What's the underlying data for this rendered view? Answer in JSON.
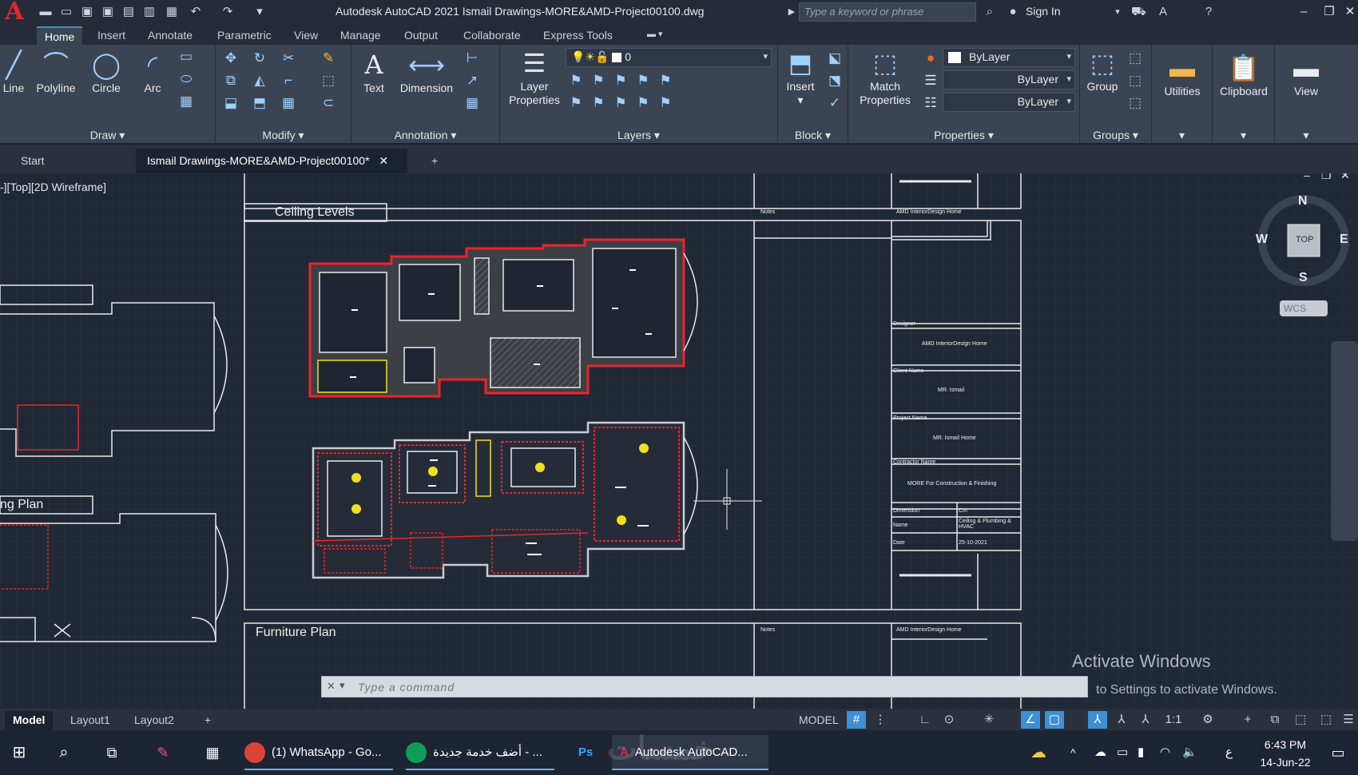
{
  "titlebar": {
    "app_title": "Autodesk AutoCAD 2021   Ismail Drawings-MORE&AMD-Project00100.dwg",
    "search_placeholder": "Type a keyword or phrase",
    "sign_in": "Sign In"
  },
  "ribbon_tabs": [
    "Home",
    "Insert",
    "Annotate",
    "Parametric",
    "View",
    "Manage",
    "Output",
    "Collaborate",
    "Express Tools"
  ],
  "panels": {
    "draw": {
      "title": "Draw",
      "tools": [
        "Line",
        "Polyline",
        "Circle",
        "Arc"
      ]
    },
    "modify": {
      "title": "Modify"
    },
    "annotation": {
      "title": "Annotation",
      "tools": [
        "Text",
        "Dimension"
      ]
    },
    "layers": {
      "title": "Layers",
      "layer_properties": "Layer Properties",
      "current_layer": "0"
    },
    "block": {
      "title": "Block",
      "insert": "Insert"
    },
    "properties": {
      "title": "Properties",
      "match": "Match Properties",
      "color": "ByLayer",
      "linetype": "ByLayer",
      "lineweight": "ByLayer"
    },
    "groups": {
      "title": "Groups",
      "group": "Group"
    },
    "utilities": "Utilities",
    "clipboard": "Clipboard",
    "view": "View"
  },
  "file_tabs": {
    "start": "Start",
    "active": "Ismail Drawings-MORE&AMD-Project00100*"
  },
  "canvas": {
    "viewport_label": "-][Top][2D Wireframe]",
    "ceiling_levels": "Ceiling Levels",
    "plan_label": "ng Plan",
    "furniture_label": "Furniture Plan",
    "notes": "Notes",
    "company": "AMD InteriorDesign Home",
    "designer_label": "Designer",
    "designer_value": "AMD InteriorDesign Home",
    "client_label": "Client Name",
    "client_value": "MR. Ismail",
    "project_label": "Project Name",
    "project_value": "MR. Ismail Home",
    "contractor_label": "Contractor Name",
    "contractor_value": "MORE For Construction & Finishing",
    "dimension_label": "Dimension",
    "dimension_value": "Cm",
    "name_label": "Name",
    "name_value": "Ceiling & Plumbing & HVAC",
    "date_label": "Date",
    "date_value": "25-10-2021",
    "compass": {
      "n": "N",
      "s": "S",
      "e": "E",
      "w": "W",
      "top": "TOP",
      "wcs": "WCS"
    },
    "command_placeholder": "Type  a  command",
    "activate_title": "Activate Windows",
    "activate_sub": "to Settings to activate Windows."
  },
  "layout_tabs": [
    "Model",
    "Layout1",
    "Layout2"
  ],
  "status": {
    "model": "MODEL",
    "scale": "1:1"
  },
  "taskbar": {
    "items": [
      "(1) WhatsApp - Go...",
      "أضف خدمة جديدة - ...",
      "Autodesk AutoCAD..."
    ],
    "time": "6:43 PM",
    "date": "14-Jun-22",
    "lang": "ع",
    "watermark": "خمسات"
  },
  "colors": {
    "accent": "#3d8fd6",
    "red": "#e8262a",
    "yellow": "#f0e020"
  }
}
